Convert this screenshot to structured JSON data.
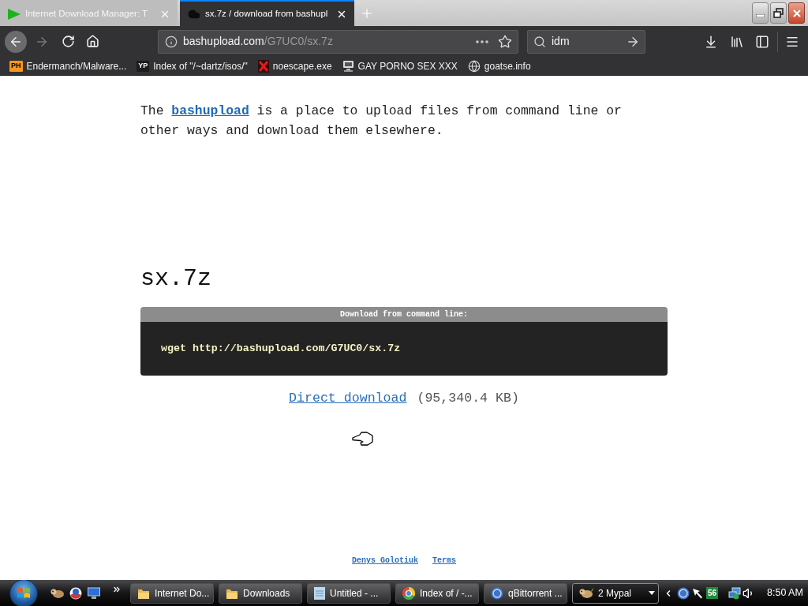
{
  "browser": {
    "tabs": [
      {
        "title": "Internet Download Manager: T",
        "kind": "play",
        "selected": false
      },
      {
        "title": "sx.7z / download from bashupl",
        "kind": "cloud",
        "selected": true
      }
    ],
    "address": {
      "domain": "bashupload.com",
      "path": "/G7UC0/sx.7z"
    },
    "search": {
      "value": "idm"
    },
    "bookmarks": [
      {
        "label": "Endermanch/Malware...",
        "kind": "tile",
        "badge": "PH",
        "color": "#f7971d"
      },
      {
        "label": "Index of \"/~dartz/isos/\"",
        "kind": "tile",
        "badge": "YP",
        "color": "#1c1c1c"
      },
      {
        "label": "noescape.exe",
        "kind": "cross"
      },
      {
        "label": "GAY PORNO SEX XXX",
        "kind": "computer"
      },
      {
        "label": "goatse.info",
        "kind": "globe"
      }
    ]
  },
  "page": {
    "intro": {
      "before": "The ",
      "link": "bashupload",
      "after": " is a place to upload files from command line or other ways and download them elsewhere."
    },
    "file_name": "sx.7z",
    "command_box": {
      "title": "Download from command line:",
      "command": "wget http://bashupload.com/G7UC0/sx.7z"
    },
    "direct_download": {
      "link": "Direct download",
      "size": "(95,340.4 KB)"
    },
    "footer_links": [
      "Denys Golotiuk",
      "Terms"
    ]
  },
  "taskbar": {
    "tasks": [
      {
        "label": "Internet Do...",
        "kind": "folder",
        "selected": false,
        "grouped": false
      },
      {
        "label": "Downloads",
        "kind": "folder",
        "selected": false,
        "grouped": false
      },
      {
        "label": "Untitled - ...",
        "kind": "notepad",
        "selected": false,
        "grouped": false
      },
      {
        "label": "Index of / -...",
        "kind": "wheel",
        "selected": false,
        "grouped": false
      },
      {
        "label": "qBittorrent ...",
        "kind": "disc",
        "selected": false,
        "grouped": false
      },
      {
        "label": "2 Mypal",
        "kind": "creature",
        "selected": true,
        "grouped": true
      }
    ],
    "tray": {
      "badge": "56",
      "clock": "8:50 AM"
    }
  }
}
